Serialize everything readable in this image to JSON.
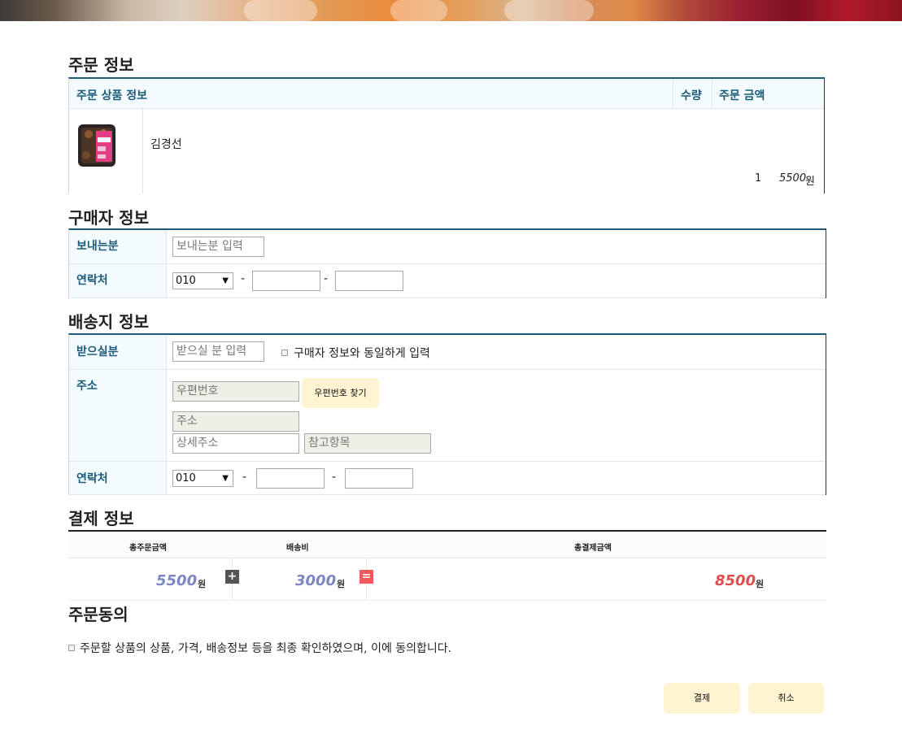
{
  "order_info": {
    "title": "주문 정보",
    "headers": {
      "product": "주문 상품 정보",
      "qty": "수량",
      "amount": "주문 금액"
    },
    "item": {
      "name": "김경선",
      "qty": "1",
      "price": "5500",
      "price_unit": "원",
      "image_icon": "food-box-image"
    }
  },
  "buyer_info": {
    "title": "구매자 정보",
    "sender_label": "보내는분",
    "sender_placeholder": "보내는분 입력",
    "contact_label": "연락처",
    "phone_prefix": "010",
    "dash": "-"
  },
  "shipping_info": {
    "title": "배송지 정보",
    "receiver_label": "받으실분",
    "receiver_placeholder": "받으실 분 입력",
    "same_as_buyer_label": "구매자 정보와 동일하게 입력",
    "address_label": "주소",
    "zipcode_placeholder": "우편번호",
    "find_zipcode_button": "우편번호 찾기",
    "address_placeholder": "주소",
    "detail_address_placeholder": "상세주소",
    "reference_placeholder": "참고항목",
    "contact_label": "연락처",
    "phone_prefix": "010",
    "dash": "-"
  },
  "payment_info": {
    "title": "결제 정보",
    "headers": {
      "total_order": "총주문금액",
      "shipping_fee": "배송비",
      "total_payment": "총결제금액"
    },
    "total_order": "5500",
    "shipping_fee": "3000",
    "total_payment": "8500",
    "unit": "원",
    "plus_icon": "+",
    "equals_icon": "="
  },
  "agreement": {
    "title": "주문동의",
    "text": "주문할 상품의 상품, 가격, 배송정보 등을 최종 확인하였으며, 이에 동의합니다."
  },
  "actions": {
    "pay_button": "결제",
    "cancel_button": "취소"
  },
  "colors": {
    "accent": "#1a5b7a",
    "button_bg": "#fef4d2",
    "amount_blue": "#7d86c4",
    "amount_red": "#e14b4b"
  }
}
